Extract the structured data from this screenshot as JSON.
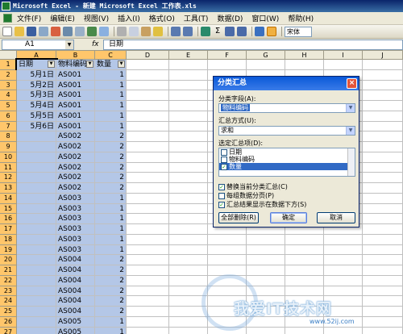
{
  "window": {
    "title": "Microsoft Excel - 新建 Microsoft Excel 工作表.xls"
  },
  "menu": {
    "items": [
      "文件(F)",
      "编辑(E)",
      "视图(V)",
      "插入(I)",
      "格式(O)",
      "工具(T)",
      "数据(D)",
      "窗口(W)",
      "帮助(H)"
    ]
  },
  "toolbar": {
    "sigma_label": "Σ",
    "font_name": "宋体"
  },
  "formula_bar": {
    "name_box": "A1",
    "fx_label": "fx",
    "content": "日期"
  },
  "sheet": {
    "columns": [
      "A",
      "B",
      "C",
      "D",
      "E",
      "F",
      "G",
      "H",
      "I",
      "J"
    ],
    "header_row": [
      "日期",
      "物料编码",
      "数量"
    ],
    "rows": [
      {
        "row": "2",
        "date": "5月1日",
        "code": "AS001",
        "qty": "1"
      },
      {
        "row": "3",
        "date": "5月2日",
        "code": "AS001",
        "qty": "1"
      },
      {
        "row": "4",
        "date": "5月3日",
        "code": "AS001",
        "qty": "1"
      },
      {
        "row": "5",
        "date": "5月4日",
        "code": "AS001",
        "qty": "1"
      },
      {
        "row": "6",
        "date": "5月5日",
        "code": "AS001",
        "qty": "1"
      },
      {
        "row": "7",
        "date": "5月6日",
        "code": "AS001",
        "qty": "1"
      },
      {
        "row": "8",
        "date": "",
        "code": "AS002",
        "qty": "2"
      },
      {
        "row": "9",
        "date": "",
        "code": "AS002",
        "qty": "2"
      },
      {
        "row": "10",
        "date": "",
        "code": "AS002",
        "qty": "2"
      },
      {
        "row": "11",
        "date": "",
        "code": "AS002",
        "qty": "2"
      },
      {
        "row": "12",
        "date": "",
        "code": "AS002",
        "qty": "2"
      },
      {
        "row": "13",
        "date": "",
        "code": "AS002",
        "qty": "2"
      },
      {
        "row": "14",
        "date": "",
        "code": "AS003",
        "qty": "1"
      },
      {
        "row": "15",
        "date": "",
        "code": "AS003",
        "qty": "1"
      },
      {
        "row": "16",
        "date": "",
        "code": "AS003",
        "qty": "1"
      },
      {
        "row": "17",
        "date": "",
        "code": "AS003",
        "qty": "1"
      },
      {
        "row": "18",
        "date": "",
        "code": "AS003",
        "qty": "1"
      },
      {
        "row": "19",
        "date": "",
        "code": "AS003",
        "qty": "1"
      },
      {
        "row": "20",
        "date": "",
        "code": "AS004",
        "qty": "2"
      },
      {
        "row": "21",
        "date": "",
        "code": "AS004",
        "qty": "2"
      },
      {
        "row": "22",
        "date": "",
        "code": "AS004",
        "qty": "2"
      },
      {
        "row": "23",
        "date": "",
        "code": "AS004",
        "qty": "2"
      },
      {
        "row": "24",
        "date": "",
        "code": "AS004",
        "qty": "2"
      },
      {
        "row": "25",
        "date": "",
        "code": "AS004",
        "qty": "2"
      },
      {
        "row": "26",
        "date": "",
        "code": "AS005",
        "qty": "1"
      },
      {
        "row": "27",
        "date": "",
        "code": "AS005",
        "qty": "1"
      }
    ]
  },
  "dialog": {
    "title": "分类汇总",
    "close_label": "×",
    "group_by_label": "分类字段(A):",
    "group_by_value": "物料编码",
    "function_label": "汇总方式(U):",
    "function_value": "求和",
    "items_label": "选定汇总项(D):",
    "items": [
      {
        "label": "日期",
        "checked": false,
        "selected": false
      },
      {
        "label": "物料编码",
        "checked": false,
        "selected": false
      },
      {
        "label": "数量",
        "checked": true,
        "selected": true
      }
    ],
    "options": [
      {
        "label": "替换当前分类汇总(C)",
        "checked": true
      },
      {
        "label": "每组数据分页(P)",
        "checked": false
      },
      {
        "label": "汇总结果显示在数据下方(S)",
        "checked": true
      }
    ],
    "buttons": {
      "remove_all": "全部删除(R)",
      "ok": "确定",
      "cancel": "取消"
    },
    "checkmark": "✓"
  },
  "watermark": {
    "text": "我爱IT技术网",
    "url": "www.52ij.com"
  }
}
